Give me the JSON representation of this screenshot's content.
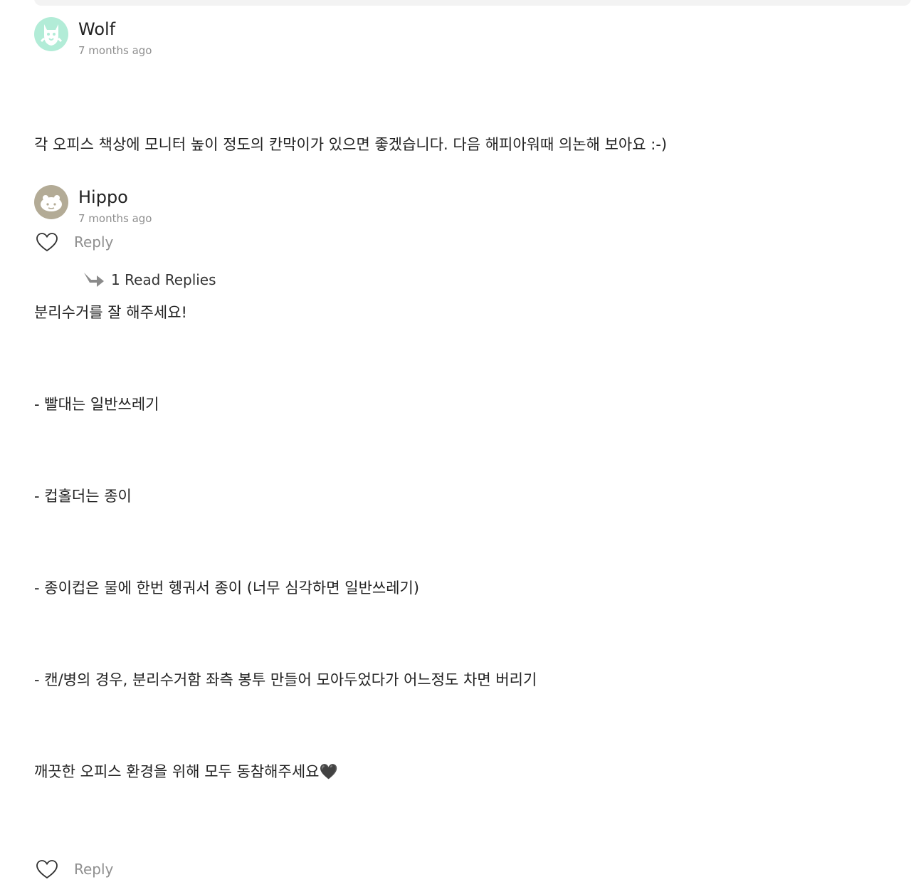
{
  "comments": [
    {
      "author": "Wolf",
      "time": "7 months ago",
      "avatar_color": "#b2ecd7",
      "avatar_icon": "wolf-avatar-icon",
      "lines": [
        "각 오피스 책상에 모니터 높이 정도의 칸막이가 있으면 좋겠습니다. 다음 해피아워때 의논해 보아요 :-)"
      ],
      "reply_label": "Reply",
      "replies_label": "1 Read Replies"
    },
    {
      "author": "Hippo",
      "time": "7 months ago",
      "avatar_color": "#b3ab96",
      "avatar_icon": "hippo-avatar-icon",
      "lines": [
        "분리수거를 잘 해주세요!",
        "- 빨대는 일반쓰레기",
        "- 컵홀더는 종이",
        "- 종이컵은 물에 한번 헹궈서 종이 (너무 심각하면 일반쓰레기)",
        "- 캔/병의 경우, 분리수거함 좌측 봉투 만들어 모아두었다가 어느정도 차면 버리기",
        "깨끗한 오피스 환경을 위해 모두 동참해주세요🖤"
      ],
      "reply_label": "Reply"
    }
  ]
}
